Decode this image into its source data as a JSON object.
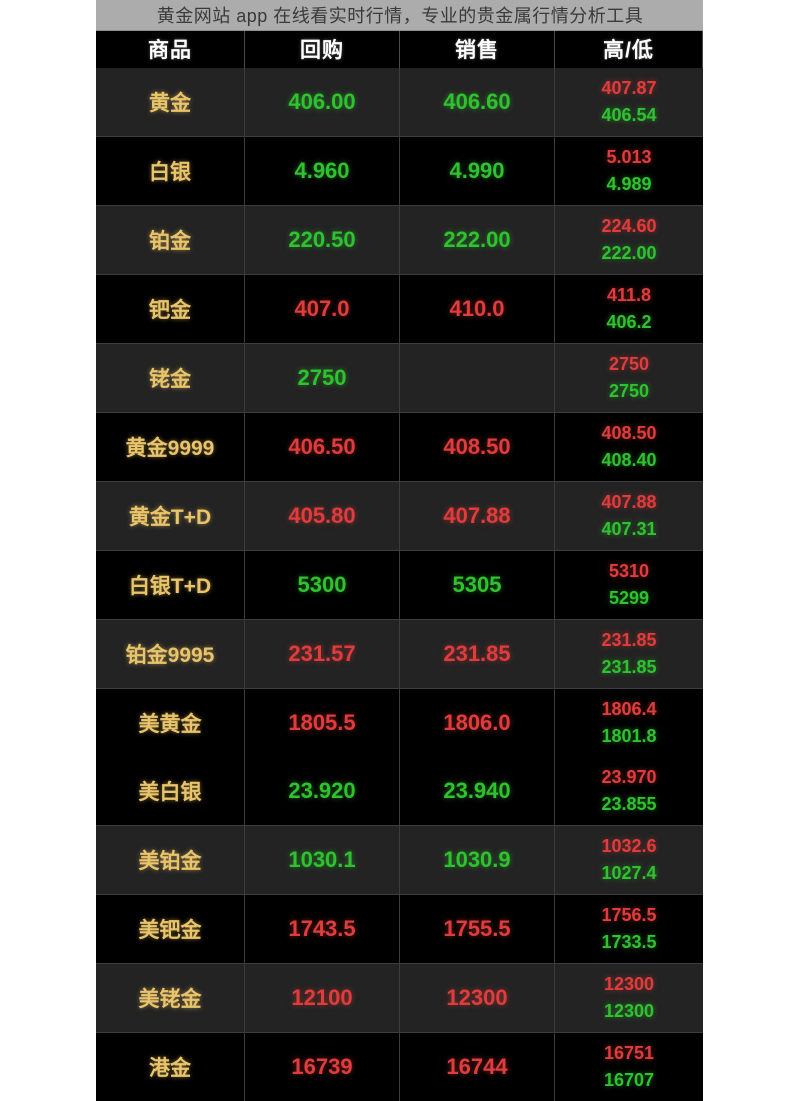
{
  "overlay": {
    "title": "黄金网站 app 在线看实时行情，专业的贵金属行情分析工具"
  },
  "table": {
    "columns": [
      {
        "key": "name",
        "label": "商品"
      },
      {
        "key": "buy",
        "label": "回购"
      },
      {
        "key": "sell",
        "label": "销售"
      },
      {
        "key": "hl",
        "label": "高/低"
      }
    ],
    "colors": {
      "up": "#e03c3c",
      "down": "#2fc22f",
      "name": "#e9c46a",
      "header_text": "#ffffff",
      "row_bg_dark": "#000000",
      "row_bg_light": "#232323",
      "divider": "#3c3c3c"
    },
    "rows": [
      {
        "name": "黄金",
        "buy": "406.00",
        "buy_dir": "down",
        "sell": "406.60",
        "sell_dir": "down",
        "high": "407.87",
        "low": "406.54",
        "bg": "light"
      },
      {
        "name": "白银",
        "buy": "4.960",
        "buy_dir": "down",
        "sell": "4.990",
        "sell_dir": "down",
        "high": "5.013",
        "low": "4.989",
        "bg": "dark"
      },
      {
        "name": "铂金",
        "buy": "220.50",
        "buy_dir": "down",
        "sell": "222.00",
        "sell_dir": "down",
        "high": "224.60",
        "low": "222.00",
        "bg": "light"
      },
      {
        "name": "钯金",
        "buy": "407.0",
        "buy_dir": "up",
        "sell": "410.0",
        "sell_dir": "up",
        "high": "411.8",
        "low": "406.2",
        "bg": "dark"
      },
      {
        "name": "铑金",
        "buy": "2750",
        "buy_dir": "down",
        "sell": "",
        "sell_dir": "down",
        "high": "2750",
        "low": "2750",
        "bg": "light"
      },
      {
        "name": "黄金9999",
        "buy": "406.50",
        "buy_dir": "up",
        "sell": "408.50",
        "sell_dir": "up",
        "high": "408.50",
        "low": "408.40",
        "bg": "dark"
      },
      {
        "name": "黄金T+D",
        "buy": "405.80",
        "buy_dir": "up",
        "sell": "407.88",
        "sell_dir": "up",
        "high": "407.88",
        "low": "407.31",
        "bg": "light"
      },
      {
        "name": "白银T+D",
        "buy": "5300",
        "buy_dir": "down",
        "sell": "5305",
        "sell_dir": "down",
        "high": "5310",
        "low": "5299",
        "bg": "dark"
      },
      {
        "name": "铂金9995",
        "buy": "231.57",
        "buy_dir": "up",
        "sell": "231.85",
        "sell_dir": "up",
        "high": "231.85",
        "low": "231.85",
        "bg": "light"
      },
      {
        "name": "美黄金",
        "buy": "1805.5",
        "buy_dir": "up",
        "sell": "1806.0",
        "sell_dir": "up",
        "high": "1806.4",
        "low": "1801.8",
        "bg": "dark"
      },
      {
        "name": "美白银",
        "buy": "23.920",
        "buy_dir": "down",
        "sell": "23.940",
        "sell_dir": "down",
        "high": "23.970",
        "low": "23.855",
        "bg": "dark"
      },
      {
        "name": "美铂金",
        "buy": "1030.1",
        "buy_dir": "down",
        "sell": "1030.9",
        "sell_dir": "down",
        "high": "1032.6",
        "low": "1027.4",
        "bg": "light"
      },
      {
        "name": "美钯金",
        "buy": "1743.5",
        "buy_dir": "up",
        "sell": "1755.5",
        "sell_dir": "up",
        "high": "1756.5",
        "low": "1733.5",
        "bg": "dark"
      },
      {
        "name": "美铑金",
        "buy": "12100",
        "buy_dir": "up",
        "sell": "12300",
        "sell_dir": "up",
        "high": "12300",
        "low": "12300",
        "bg": "light"
      },
      {
        "name": "港金",
        "buy": "16739",
        "buy_dir": "up",
        "sell": "16744",
        "sell_dir": "up",
        "high": "16751",
        "low": "16707",
        "bg": "dark"
      }
    ]
  }
}
